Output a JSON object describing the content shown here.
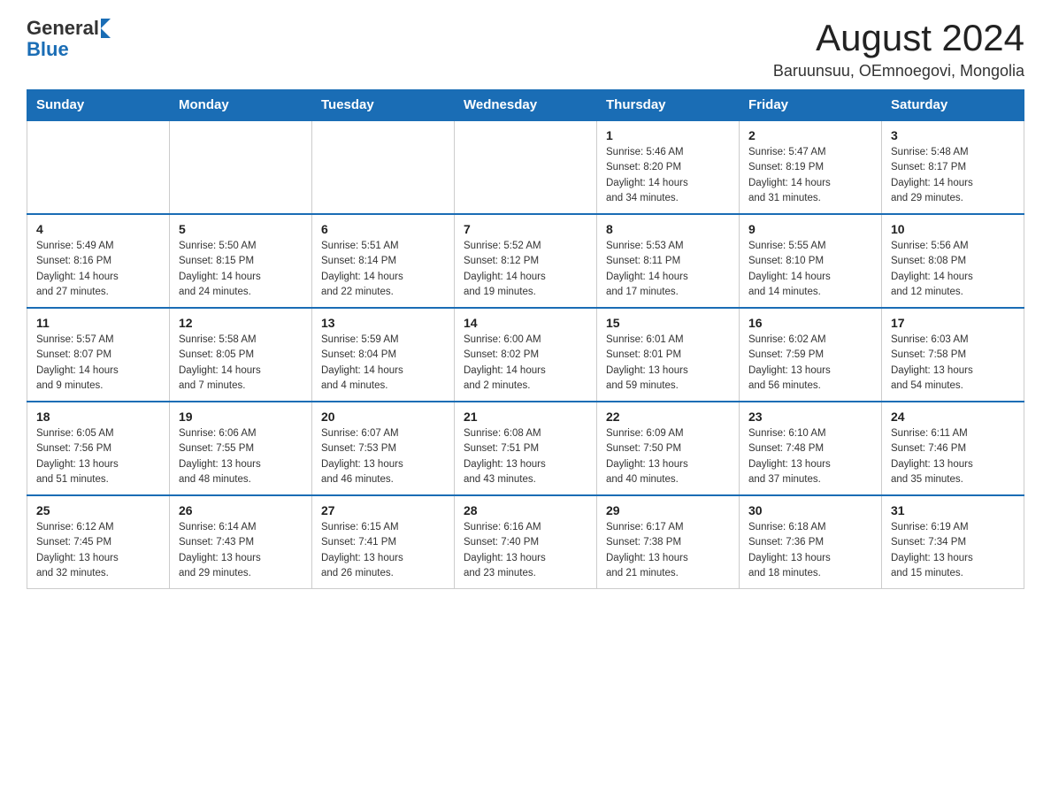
{
  "header": {
    "logo_general": "General",
    "logo_blue": "Blue",
    "month_year": "August 2024",
    "location": "Baruunsuu, OEmnoegovi, Mongolia"
  },
  "days_of_week": [
    "Sunday",
    "Monday",
    "Tuesday",
    "Wednesday",
    "Thursday",
    "Friday",
    "Saturday"
  ],
  "weeks": [
    [
      {
        "day": "",
        "info": ""
      },
      {
        "day": "",
        "info": ""
      },
      {
        "day": "",
        "info": ""
      },
      {
        "day": "",
        "info": ""
      },
      {
        "day": "1",
        "info": "Sunrise: 5:46 AM\nSunset: 8:20 PM\nDaylight: 14 hours\nand 34 minutes."
      },
      {
        "day": "2",
        "info": "Sunrise: 5:47 AM\nSunset: 8:19 PM\nDaylight: 14 hours\nand 31 minutes."
      },
      {
        "day": "3",
        "info": "Sunrise: 5:48 AM\nSunset: 8:17 PM\nDaylight: 14 hours\nand 29 minutes."
      }
    ],
    [
      {
        "day": "4",
        "info": "Sunrise: 5:49 AM\nSunset: 8:16 PM\nDaylight: 14 hours\nand 27 minutes."
      },
      {
        "day": "5",
        "info": "Sunrise: 5:50 AM\nSunset: 8:15 PM\nDaylight: 14 hours\nand 24 minutes."
      },
      {
        "day": "6",
        "info": "Sunrise: 5:51 AM\nSunset: 8:14 PM\nDaylight: 14 hours\nand 22 minutes."
      },
      {
        "day": "7",
        "info": "Sunrise: 5:52 AM\nSunset: 8:12 PM\nDaylight: 14 hours\nand 19 minutes."
      },
      {
        "day": "8",
        "info": "Sunrise: 5:53 AM\nSunset: 8:11 PM\nDaylight: 14 hours\nand 17 minutes."
      },
      {
        "day": "9",
        "info": "Sunrise: 5:55 AM\nSunset: 8:10 PM\nDaylight: 14 hours\nand 14 minutes."
      },
      {
        "day": "10",
        "info": "Sunrise: 5:56 AM\nSunset: 8:08 PM\nDaylight: 14 hours\nand 12 minutes."
      }
    ],
    [
      {
        "day": "11",
        "info": "Sunrise: 5:57 AM\nSunset: 8:07 PM\nDaylight: 14 hours\nand 9 minutes."
      },
      {
        "day": "12",
        "info": "Sunrise: 5:58 AM\nSunset: 8:05 PM\nDaylight: 14 hours\nand 7 minutes."
      },
      {
        "day": "13",
        "info": "Sunrise: 5:59 AM\nSunset: 8:04 PM\nDaylight: 14 hours\nand 4 minutes."
      },
      {
        "day": "14",
        "info": "Sunrise: 6:00 AM\nSunset: 8:02 PM\nDaylight: 14 hours\nand 2 minutes."
      },
      {
        "day": "15",
        "info": "Sunrise: 6:01 AM\nSunset: 8:01 PM\nDaylight: 13 hours\nand 59 minutes."
      },
      {
        "day": "16",
        "info": "Sunrise: 6:02 AM\nSunset: 7:59 PM\nDaylight: 13 hours\nand 56 minutes."
      },
      {
        "day": "17",
        "info": "Sunrise: 6:03 AM\nSunset: 7:58 PM\nDaylight: 13 hours\nand 54 minutes."
      }
    ],
    [
      {
        "day": "18",
        "info": "Sunrise: 6:05 AM\nSunset: 7:56 PM\nDaylight: 13 hours\nand 51 minutes."
      },
      {
        "day": "19",
        "info": "Sunrise: 6:06 AM\nSunset: 7:55 PM\nDaylight: 13 hours\nand 48 minutes."
      },
      {
        "day": "20",
        "info": "Sunrise: 6:07 AM\nSunset: 7:53 PM\nDaylight: 13 hours\nand 46 minutes."
      },
      {
        "day": "21",
        "info": "Sunrise: 6:08 AM\nSunset: 7:51 PM\nDaylight: 13 hours\nand 43 minutes."
      },
      {
        "day": "22",
        "info": "Sunrise: 6:09 AM\nSunset: 7:50 PM\nDaylight: 13 hours\nand 40 minutes."
      },
      {
        "day": "23",
        "info": "Sunrise: 6:10 AM\nSunset: 7:48 PM\nDaylight: 13 hours\nand 37 minutes."
      },
      {
        "day": "24",
        "info": "Sunrise: 6:11 AM\nSunset: 7:46 PM\nDaylight: 13 hours\nand 35 minutes."
      }
    ],
    [
      {
        "day": "25",
        "info": "Sunrise: 6:12 AM\nSunset: 7:45 PM\nDaylight: 13 hours\nand 32 minutes."
      },
      {
        "day": "26",
        "info": "Sunrise: 6:14 AM\nSunset: 7:43 PM\nDaylight: 13 hours\nand 29 minutes."
      },
      {
        "day": "27",
        "info": "Sunrise: 6:15 AM\nSunset: 7:41 PM\nDaylight: 13 hours\nand 26 minutes."
      },
      {
        "day": "28",
        "info": "Sunrise: 6:16 AM\nSunset: 7:40 PM\nDaylight: 13 hours\nand 23 minutes."
      },
      {
        "day": "29",
        "info": "Sunrise: 6:17 AM\nSunset: 7:38 PM\nDaylight: 13 hours\nand 21 minutes."
      },
      {
        "day": "30",
        "info": "Sunrise: 6:18 AM\nSunset: 7:36 PM\nDaylight: 13 hours\nand 18 minutes."
      },
      {
        "day": "31",
        "info": "Sunrise: 6:19 AM\nSunset: 7:34 PM\nDaylight: 13 hours\nand 15 minutes."
      }
    ]
  ]
}
